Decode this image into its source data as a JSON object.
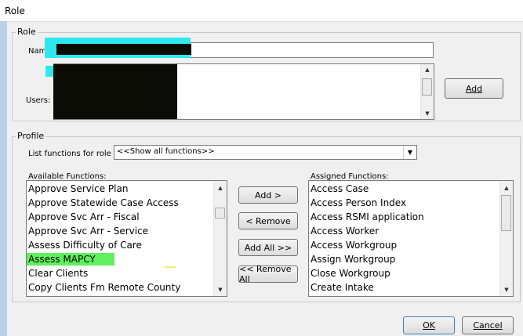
{
  "window": {
    "title": "Role"
  },
  "role_group": {
    "legend": "Role",
    "name_label": "Name:",
    "users_label": "Users:",
    "add_button": "Add"
  },
  "profile_group": {
    "legend": "Profile",
    "list_functions_label": "List functions for role",
    "filter_value": "<<Show all functions>>",
    "available_label": "Available Functions:",
    "assigned_label": "Assigned Functions:",
    "available": [
      "Approve Service Plan",
      "Approve Statewide Case Access",
      "Approve Svc Arr - Fiscal",
      "Approve Svc Arr - Service",
      "Assess Difficulty of Care",
      "Assess MAPCY",
      "Clear Clients",
      "Copy Clients Fm Remote County"
    ],
    "assigned": [
      "Access Case",
      "Access Person Index",
      "Access RSMI application",
      "Access Worker",
      "Access Workgroup",
      "Assign Workgroup",
      "Close Workgroup",
      "Create Intake"
    ],
    "buttons": {
      "add": "Add >",
      "remove": "< Remove",
      "add_all": "Add All >>",
      "remove_all": "<< Remove All"
    }
  },
  "footer": {
    "ok": "OK",
    "cancel": "Cancel"
  },
  "colors": {
    "highlight_cyan": "#2ee8ee",
    "highlight_green": "#5ef05e",
    "redaction": "#0c0c06"
  }
}
